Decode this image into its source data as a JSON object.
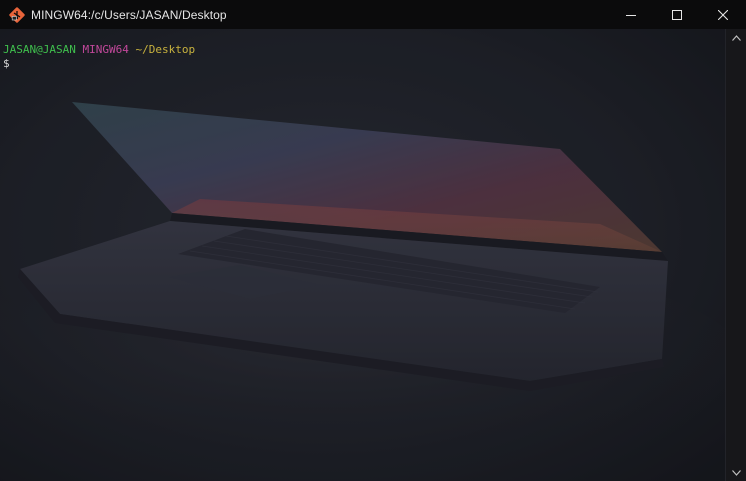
{
  "window": {
    "title": "MINGW64:/c/Users/JASAN/Desktop",
    "app_icon": "git-bash-icon",
    "controls": [
      "minimize-icon",
      "maximize-icon",
      "close-icon"
    ]
  },
  "terminal": {
    "user_host": "JASAN@JASAN",
    "system": "MINGW64",
    "cwd": "~/Desktop",
    "prompt_symbol": "$"
  },
  "background": {
    "description_icon": "laptop-wallpaper"
  },
  "colors": {
    "titlebar": "#0b0b0c",
    "terminal_bg": "#1c1f27",
    "user_host": "#3fbf4d",
    "system": "#c2489b",
    "cwd": "#c8b23e",
    "prompt": "#d9d9d9"
  }
}
